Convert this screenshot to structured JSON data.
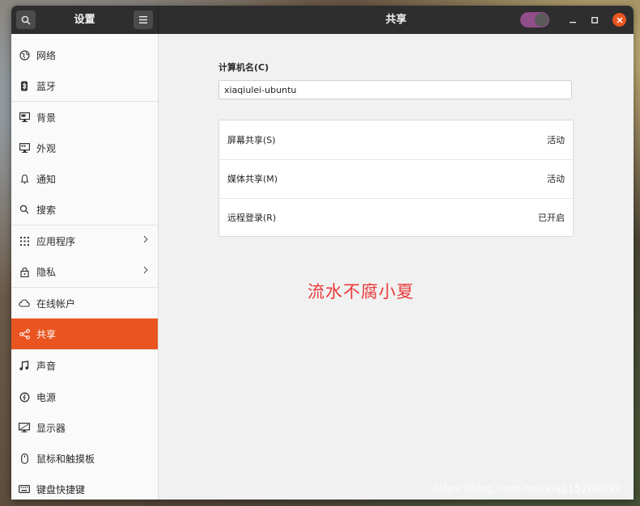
{
  "titlebar": {
    "left_title": "设置",
    "center_title": "共享",
    "toggle_on": true
  },
  "sidebar": {
    "items": [
      {
        "label": "网络",
        "icon": "network-icon"
      },
      {
        "label": "蓝牙",
        "icon": "bluetooth-icon"
      },
      {
        "label": "背景",
        "icon": "monitor-icon"
      },
      {
        "label": "外观",
        "icon": "appearance-icon"
      },
      {
        "label": "通知",
        "icon": "bell-icon"
      },
      {
        "label": "搜索",
        "icon": "search-icon"
      },
      {
        "label": "应用程序",
        "icon": "apps-grid-icon"
      },
      {
        "label": "隐私",
        "icon": "lock-icon"
      },
      {
        "label": "在线帐户",
        "icon": "cloud-icon"
      },
      {
        "label": "共享",
        "icon": "share-icon"
      },
      {
        "label": "声音",
        "icon": "music-note-icon"
      },
      {
        "label": "电源",
        "icon": "power-icon"
      },
      {
        "label": "显示器",
        "icon": "display-icon"
      },
      {
        "label": "鼠标和触摸板",
        "icon": "mouse-icon"
      },
      {
        "label": "键盘快捷键",
        "icon": "keyboard-icon"
      }
    ],
    "active": "共享"
  },
  "main": {
    "computer_name_label": "计算机名(C)",
    "computer_name_value": "xiaqiulei-ubuntu",
    "rows": [
      {
        "label": "屏幕共享(S)",
        "status": "活动"
      },
      {
        "label": "媒体共享(M)",
        "status": "活动"
      },
      {
        "label": "远程登录(R)",
        "status": "已开启"
      }
    ],
    "overlay_text": "流水不腐小夏"
  },
  "watermark": "https://blog.csdn.net/xia215266092",
  "colors": {
    "accent": "#e95420",
    "toggle": "#924d8b",
    "titlebar": "#2e2e2e",
    "overlay_text": "#e83a3a"
  }
}
